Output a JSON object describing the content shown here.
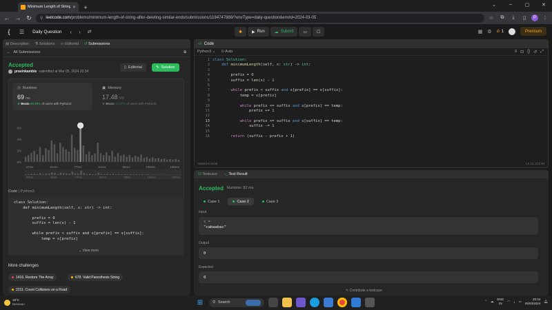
{
  "browser": {
    "tab_title": "Minimum Length of String Aft",
    "url_host": "leetcode.com",
    "url_path": "/problems/minimum-length-of-string-after-deleting-similar-ends/submissions/1194747888/?envType=daily-question&envId=2024-03-05",
    "profile_initial": "P"
  },
  "lc_nav": {
    "problem_list": "Daily Question",
    "run_label": "Run",
    "submit_label": "Submit",
    "streak": "1",
    "premium_label": "Premium"
  },
  "left": {
    "tabs": [
      "Description",
      "Solutions",
      "Editorial",
      "Submissions"
    ],
    "all_submissions": "All Submissions",
    "status": "Accepted",
    "submitter": "pravinkamble",
    "submitted_text": "submitted at Mar 05, 2024 20:34",
    "editorial_btn": "Editorial",
    "solution_btn": "Solution",
    "runtime": {
      "title": "Runtime",
      "value": "69",
      "unit": "ms",
      "beats_label": "Beats",
      "beats_pct": "88.88%",
      "beats_suffix": "of users with Python3"
    },
    "memory": {
      "title": "Memory",
      "value": "17.48",
      "unit": "MB",
      "beats_label": "Beats",
      "beats_pct": "12.57%",
      "beats_suffix": "of users with Python3"
    },
    "code_label": "Code",
    "code_lang": "Python3",
    "code_lines": [
      "class Solution:",
      "    def minimumLength(self, s: str) -> int:",
      "",
      "        prefix = 0",
      "        suffix = len(s) - 1",
      "",
      "        while prefix < suffix and s[prefix] == s[suffix]:",
      "            temp = s[prefix]"
    ],
    "view_more": "View more",
    "more_challenges": "More challenges",
    "challenges": [
      "1416. Restore The Array",
      "678. Valid Parenthesis String",
      "2211. Count Collisions on a Road"
    ]
  },
  "chart_data": {
    "type": "bar",
    "title": "",
    "xlabel": "",
    "ylabel": "",
    "x_ticks": [
      "47ms",
      "61ms",
      "77ms",
      "81ms",
      "95ms",
      "109ms",
      "155ms"
    ],
    "y_ticks": [
      "0%",
      "2%",
      "4%",
      "6%"
    ],
    "ylim": [
      0,
      8
    ],
    "values": [
      0.9,
      1.2,
      1.6,
      1.9,
      1.3,
      2.6,
      1.2,
      2.4,
      2.1,
      3.8,
      3.1,
      1.5,
      3.4,
      2.6,
      2.2,
      1.8,
      4.8,
      2.5,
      2.1,
      6.4,
      2.9,
      1.3,
      1.8,
      1.2,
      1.5,
      3.4,
      1.5,
      1.2,
      1.7,
      1.1,
      1.9,
      0.9,
      1.6,
      1.1,
      1.3,
      0.9,
      1.2,
      0.8,
      1.1,
      0.9,
      1.3,
      0.7,
      0.9,
      0.6,
      0.8,
      0.6,
      0.7,
      0.5,
      0.6,
      0.4,
      0.5,
      0.4,
      0.5,
      0.4
    ],
    "highlight_index": 19,
    "minimap_ticks": [
      "47ms",
      "61ms",
      "77ms",
      "81ms",
      "95ms",
      "109ms",
      "155ms"
    ]
  },
  "editor": {
    "title": "Code",
    "lang": "Python3",
    "mode": "Auto",
    "footer_left": "Saved to local",
    "footer_right": "Ln 13, Col 40"
  },
  "result": {
    "tabs": [
      "Testcase",
      "Test Result"
    ],
    "status": "Accepted",
    "runtime": "Runtime: 82 ms",
    "cases": [
      "Case 1",
      "Case 2",
      "Case 3"
    ],
    "input_label": "Input",
    "input_key": "s =",
    "input_value": "\"cabaabac\"",
    "output_label": "Output",
    "output_value": "0",
    "expected_label": "Expected",
    "expected_value": "0",
    "contribute": "Contribute a testcase"
  },
  "taskbar": {
    "temp": "19°C",
    "weather": "Berawan",
    "search": "Search",
    "lang": "ENG",
    "region": "IN",
    "time": "20:34",
    "date": "05/03/2024"
  }
}
